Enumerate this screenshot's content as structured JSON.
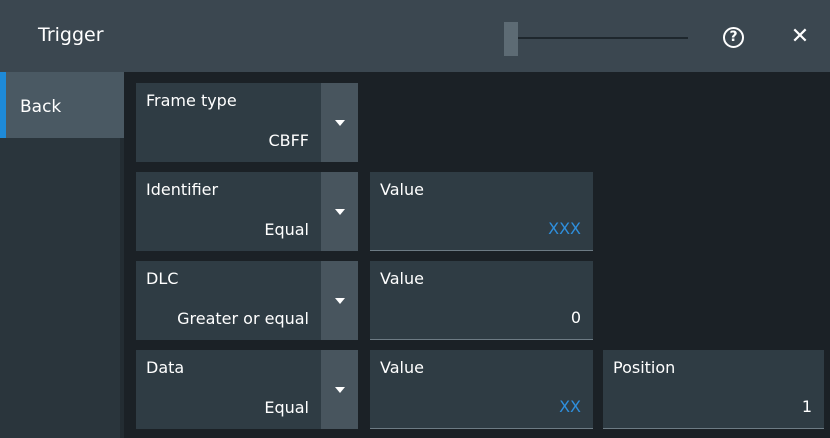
{
  "title": "Trigger",
  "header": {
    "slider_name": "transparency-slider",
    "help_icon": "?",
    "close_icon": "✕"
  },
  "sidebar": {
    "back_label": "Back"
  },
  "rows": {
    "frame_type": {
      "label": "Frame type",
      "value": "CBFF"
    },
    "identifier": {
      "label": "Identifier",
      "value": "Equal",
      "value_label": "Value",
      "value_text": "XXX"
    },
    "dlc": {
      "label": "DLC",
      "value": "Greater or equal",
      "value_label": "Value",
      "value_text": "0"
    },
    "data": {
      "label": "Data",
      "value": "Equal",
      "value_label": "Value",
      "value_text": "XX",
      "position_label": "Position",
      "position_value": "1"
    }
  },
  "colors": {
    "accent": "#1e8ad8",
    "value_blue": "#2e8fdd",
    "background": "#1b2126",
    "titlebar": "#3b4750",
    "cell": "#2f3c44"
  }
}
